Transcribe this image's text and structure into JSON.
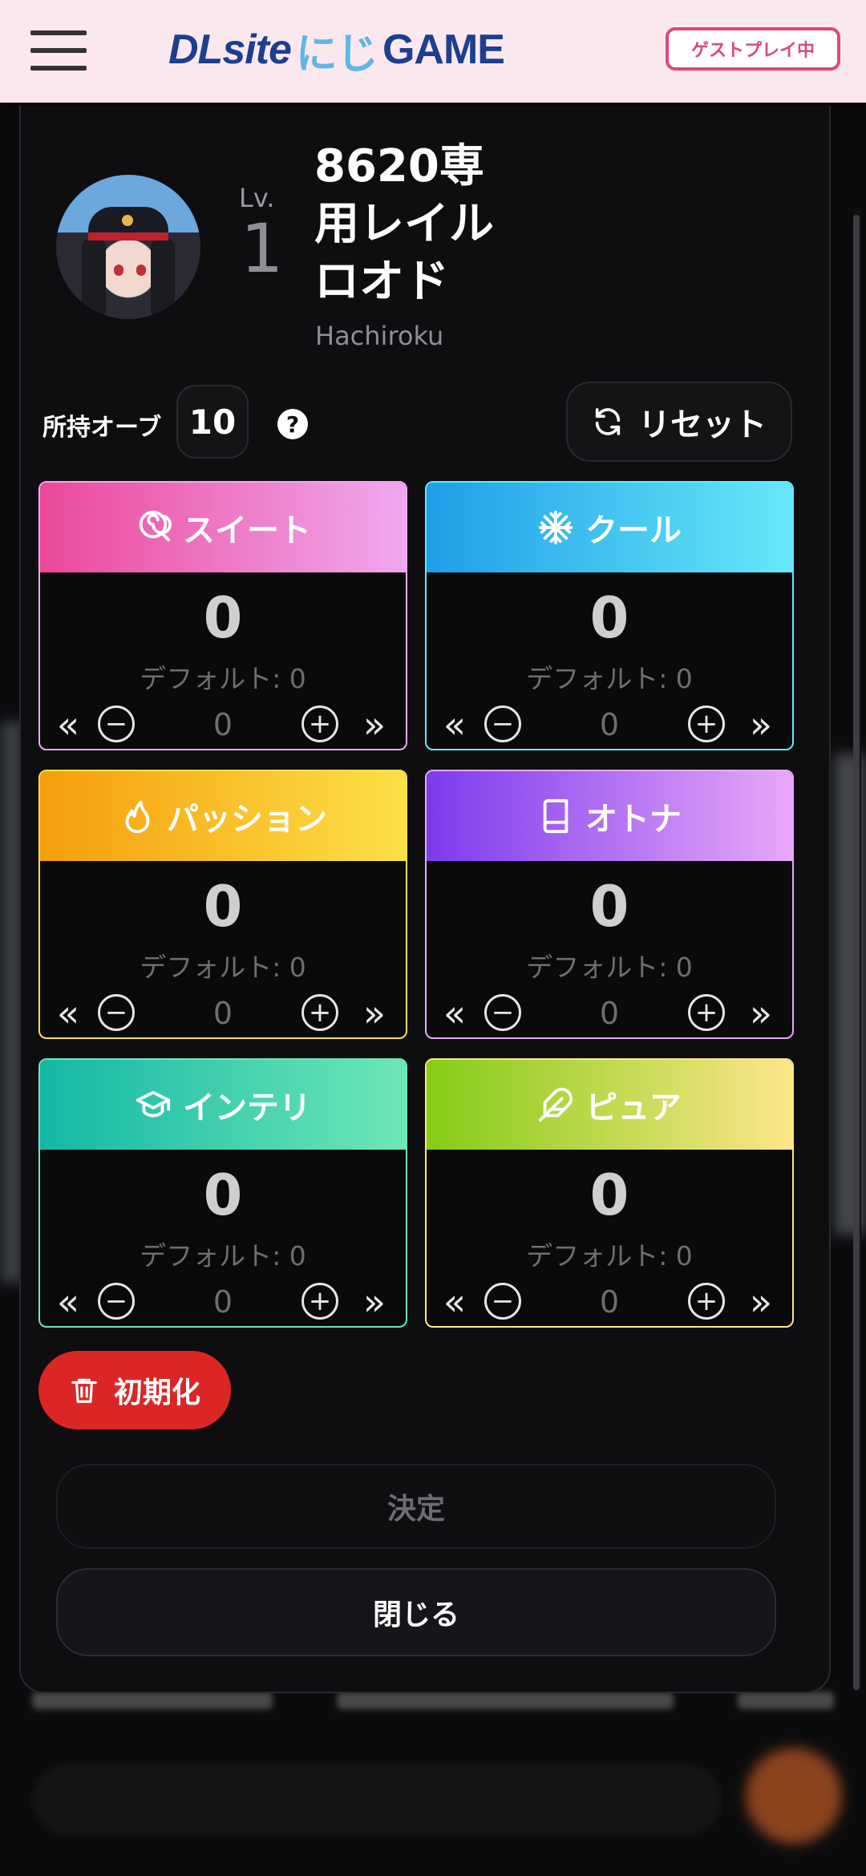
{
  "header": {
    "logo_dl": "DLsite",
    "logo_nj": "にじ",
    "logo_game": "GAME",
    "guest_label": "ゲストプレイ中"
  },
  "character": {
    "level_label": "Lv.",
    "level": "1",
    "name": "8620専用レイルロオド",
    "sub_name": "Hachiroku"
  },
  "orbs": {
    "label": "所持オーブ",
    "count": "10",
    "help": "?",
    "reset_label": "リセット"
  },
  "stats": [
    {
      "name": "スイート",
      "value": "0",
      "default_label": "デフォルト: 0",
      "step": "0",
      "icon": "lollipop-icon",
      "gradient": [
        "#ec4899",
        "#f0a8f0"
      ],
      "border": "#f0a8f0"
    },
    {
      "name": "クール",
      "value": "0",
      "default_label": "デフォルト: 0",
      "step": "0",
      "icon": "snowflake-icon",
      "gradient": [
        "#1e9fe8",
        "#67e8f9"
      ],
      "border": "#67e8f9"
    },
    {
      "name": "パッション",
      "value": "0",
      "default_label": "デフォルト: 0",
      "step": "0",
      "icon": "flame-icon",
      "gradient": [
        "#f59e0b",
        "#fde047"
      ],
      "border": "#fde047"
    },
    {
      "name": "オトナ",
      "value": "0",
      "default_label": "デフォルト: 0",
      "step": "0",
      "icon": "book-icon",
      "gradient": [
        "#7c3aed",
        "#e9a8f8"
      ],
      "border": "#e9a8f8"
    },
    {
      "name": "インテリ",
      "value": "0",
      "default_label": "デフォルト: 0",
      "step": "0",
      "icon": "graduation-cap-icon",
      "gradient": [
        "#14b8a6",
        "#6ee7b7"
      ],
      "border": "#6ee7b7"
    },
    {
      "name": "ピュア",
      "value": "0",
      "default_label": "デフォルト: 0",
      "step": "0",
      "icon": "feather-icon",
      "gradient": [
        "#84cc16",
        "#fde68a"
      ],
      "border": "#fde68a"
    }
  ],
  "controls": {
    "fast_decrease": "«",
    "decrease": "−",
    "increase": "+",
    "fast_increase": "»"
  },
  "actions": {
    "init_label": "初期化",
    "confirm_label": "決定",
    "close_label": "閉じる"
  }
}
